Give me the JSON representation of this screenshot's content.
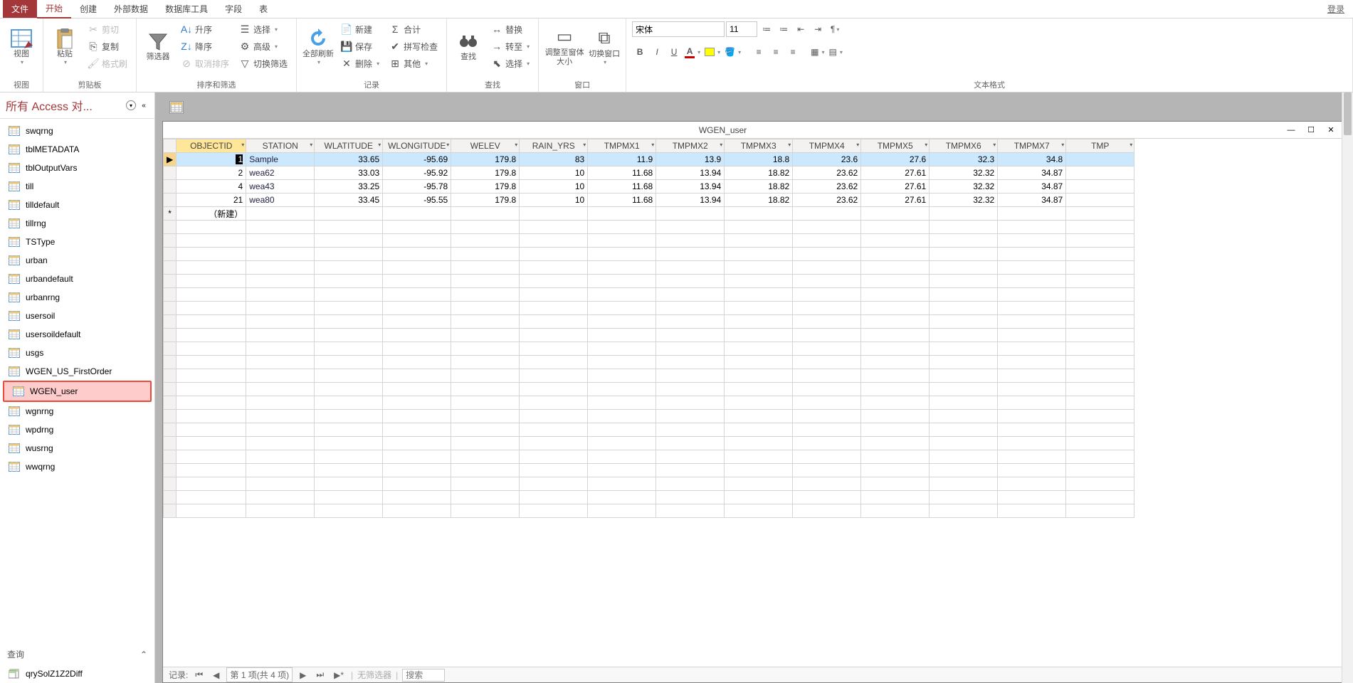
{
  "menu": {
    "file": "文件",
    "tabs": [
      "开始",
      "创建",
      "外部数据",
      "数据库工具",
      "字段",
      "表"
    ],
    "active": "开始",
    "login": "登录"
  },
  "ribbon": {
    "view": {
      "label": "视图",
      "group": "视图"
    },
    "clipboard": {
      "paste": "粘贴",
      "cut": "剪切",
      "copy": "复制",
      "formatPainter": "格式刷",
      "group": "剪贴板"
    },
    "sort": {
      "filter": "筛选器",
      "asc": "升序",
      "desc": "降序",
      "cancelSort": "取消排序",
      "select": "选择",
      "advanced": "高级",
      "toggleFilter": "切换筛选",
      "group": "排序和筛选"
    },
    "records": {
      "refresh": "全部刷新",
      "new": "新建",
      "save": "保存",
      "delete": "删除",
      "sum": "合计",
      "spell": "拼写检查",
      "other": "其他",
      "group": "记录"
    },
    "find": {
      "find": "查找",
      "replace": "替换",
      "goto": "转至",
      "select": "选择",
      "group": "查找"
    },
    "window": {
      "size": "调整至窗体大小",
      "switch": "切换窗口",
      "group": "窗口"
    },
    "textfmt": {
      "fontName": "宋体",
      "fontSize": "11",
      "group": "文本格式"
    }
  },
  "nav": {
    "title": "所有 Access 对...",
    "items": [
      "swqrng",
      "tblMETADATA",
      "tblOutputVars",
      "till",
      "tilldefault",
      "tillrng",
      "TSType",
      "urban",
      "urbandefault",
      "urbanrng",
      "usersoil",
      "usersoildefault",
      "usgs",
      "WGEN_US_FirstOrder",
      "WGEN_user",
      "wgnrng",
      "wpdrng",
      "wusrng",
      "wwqrng"
    ],
    "selected": "WGEN_user",
    "queryGroup": "查询",
    "queryItems": [
      "qrySolZ1Z2Diff"
    ]
  },
  "doc": {
    "title": "WGEN_user",
    "columns": [
      "OBJECTID",
      "STATION",
      "WLATITUDE",
      "WLONGITUDE",
      "WELEV",
      "RAIN_YRS",
      "TMPMX1",
      "TMPMX2",
      "TMPMX3",
      "TMPMX4",
      "TMPMX5",
      "TMPMX6",
      "TMPMX7",
      "TMP"
    ],
    "rows": [
      {
        "OBJECTID": "1",
        "STATION": "Sample",
        "WLATITUDE": "33.65",
        "WLONGITUDE": "-95.69",
        "WELEV": "179.8",
        "RAIN_YRS": "83",
        "TMPMX1": "11.9",
        "TMPMX2": "13.9",
        "TMPMX3": "18.8",
        "TMPMX4": "23.6",
        "TMPMX5": "27.6",
        "TMPMX6": "32.3",
        "TMPMX7": "34.8",
        "selected": true,
        "editing": true
      },
      {
        "OBJECTID": "2",
        "STATION": "wea62",
        "WLATITUDE": "33.03",
        "WLONGITUDE": "-95.92",
        "WELEV": "179.8",
        "RAIN_YRS": "10",
        "TMPMX1": "11.68",
        "TMPMX2": "13.94",
        "TMPMX3": "18.82",
        "TMPMX4": "23.62",
        "TMPMX5": "27.61",
        "TMPMX6": "32.32",
        "TMPMX7": "34.87"
      },
      {
        "OBJECTID": "4",
        "STATION": "wea43",
        "WLATITUDE": "33.25",
        "WLONGITUDE": "-95.78",
        "WELEV": "179.8",
        "RAIN_YRS": "10",
        "TMPMX1": "11.68",
        "TMPMX2": "13.94",
        "TMPMX3": "18.82",
        "TMPMX4": "23.62",
        "TMPMX5": "27.61",
        "TMPMX6": "32.32",
        "TMPMX7": "34.87"
      },
      {
        "OBJECTID": "21",
        "STATION": "wea80",
        "WLATITUDE": "33.45",
        "WLONGITUDE": "-95.55",
        "WELEV": "179.8",
        "RAIN_YRS": "10",
        "TMPMX1": "11.68",
        "TMPMX2": "13.94",
        "TMPMX3": "18.82",
        "TMPMX4": "23.62",
        "TMPMX5": "27.61",
        "TMPMX6": "32.32",
        "TMPMX7": "34.87"
      }
    ],
    "newRow": "（新建）",
    "status": {
      "label": "记录:",
      "pos": "第 1 项(共 4 项)",
      "noFilter": "无筛选器",
      "search": "搜索"
    }
  }
}
